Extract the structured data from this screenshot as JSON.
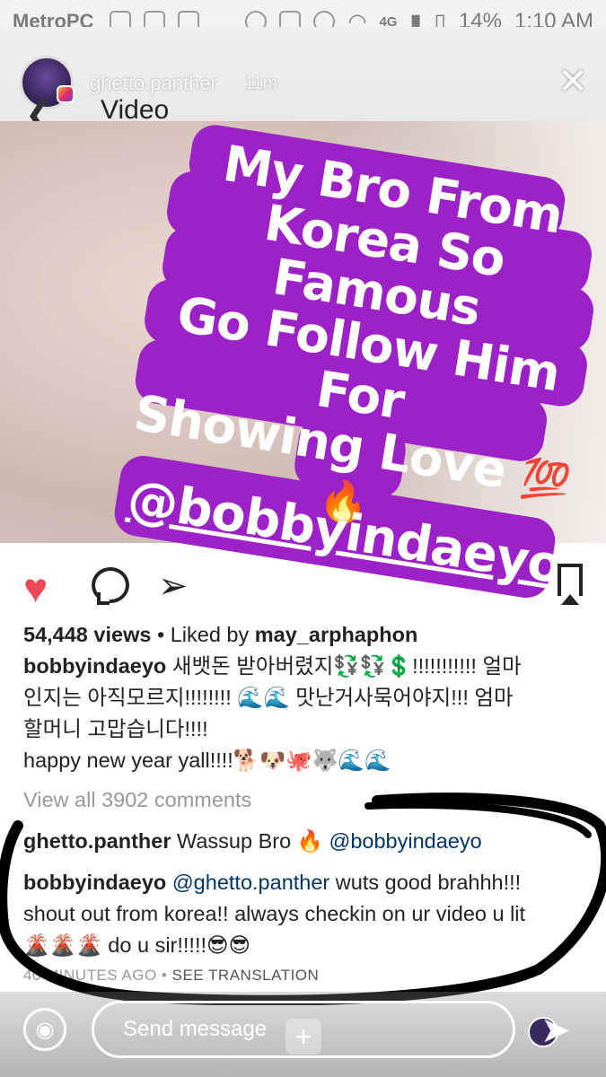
{
  "status_bar": {
    "carrier": "MetroPC",
    "network": "4G",
    "battery": "14%",
    "time": "1:10 AM"
  },
  "story": {
    "username": "ghetto.panther",
    "time_ago": "11m",
    "close_icon": "close-icon"
  },
  "header": {
    "back_icon": "back-arrow-icon",
    "title": "Video"
  },
  "sticker": {
    "line1": "My Bro From",
    "line2": "Korea So Famous",
    "line3": "Go Follow Him For",
    "line4": "Showing Love",
    "emoji1": "💯",
    "emoji2": "🔥",
    "handle": "@bobbyindaeyo",
    "color": "#9c22c7"
  },
  "post": {
    "views": "54,448 views",
    "liked_by_prefix": " • Liked by ",
    "liked_by_user": "may_arphaphon",
    "caption_user": "bobbyindaeyo",
    "caption_text_1": " 새뱃돈 받아버렸지💱💱💲!!!!!!!!!!! 얼마",
    "caption_text_2": "인지는 아직모르지!!!!!!!! 🌊🌊 맛난거사묵어야지!!! 엄마",
    "caption_text_3": "할머니 고맙습니다!!!!",
    "caption_text_4": "happy new year yall!!!!🐕🐶🐙🐺🌊🌊",
    "view_all": "View all 3902 comments"
  },
  "comments": [
    {
      "user": "ghetto.panther",
      "text": " Wassup Bro 🔥 ",
      "mention": "@bobbyindaeyo"
    },
    {
      "user": "bobbyindaeyo",
      "mention": "@ghetto.panther",
      "text_1": " wuts good brahhh!!!",
      "text_2": "shout out from korea!! always checkin on ur video u lit",
      "text_3": "🌋🌋🌋 do u sir!!!!!😎😎"
    }
  ],
  "meta": {
    "time": "40 MINUTES AGO",
    "sep": " • ",
    "translate": "SEE TRANSLATION"
  },
  "reply_bar": {
    "placeholder": "Send message"
  },
  "colors": {
    "heart": "#ed4956",
    "mention": "#003569"
  }
}
